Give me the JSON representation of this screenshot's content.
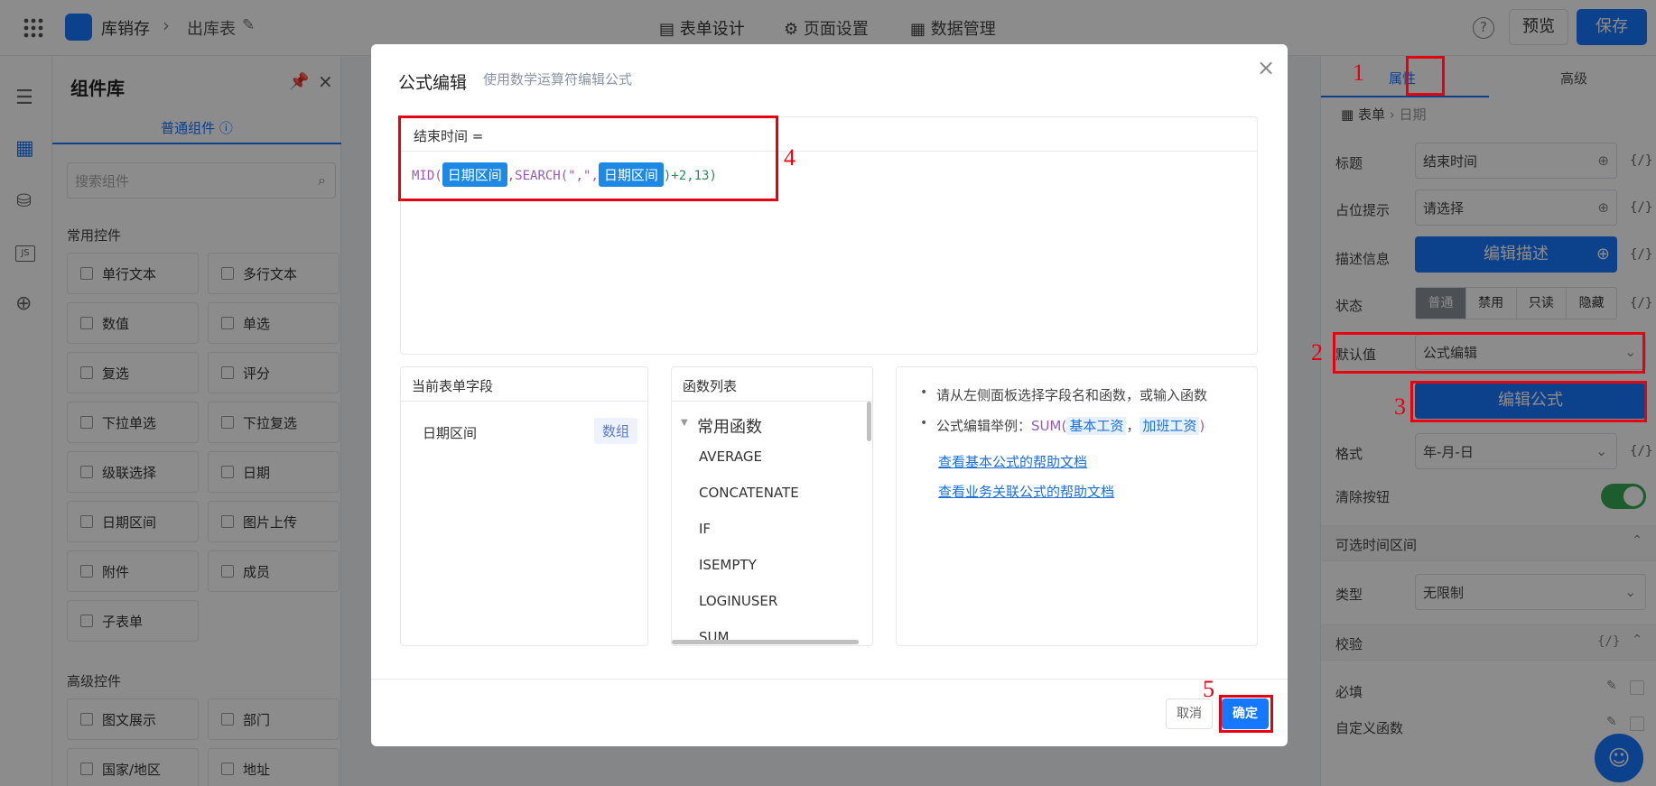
{
  "topbar": {
    "app": "库销存",
    "page": "出库表",
    "tabs": [
      "表单设计",
      "页面设置",
      "数据管理"
    ],
    "preview": "预览",
    "save": "保存"
  },
  "comp": {
    "title": "组件库",
    "tab": "普通组件",
    "search_placeholder": "搜索组件",
    "section1": "常用控件",
    "items": [
      "单行文本",
      "多行文本",
      "数值",
      "单选",
      "复选",
      "评分",
      "下拉单选",
      "下拉复选",
      "级联选择",
      "日期",
      "日期区间",
      "图片上传",
      "附件",
      "成员",
      "子表单"
    ],
    "section2": "高级控件",
    "items2": [
      "图文展示",
      "部门",
      "国家/地区",
      "地址"
    ]
  },
  "rpanel": {
    "tabs": [
      "属性",
      "高级"
    ],
    "crumb": [
      "表单",
      "日期"
    ],
    "title_label": "标题",
    "title_value": "结束时间",
    "ph_label": "占位提示",
    "ph_value": "请选择",
    "desc_label": "描述信息",
    "desc_btn": "编辑描述",
    "state_label": "状态",
    "states": [
      "普通",
      "禁用",
      "只读",
      "隐藏"
    ],
    "default_label": "默认值",
    "default_value": "公式编辑",
    "edit_formula": "编辑公式",
    "format_label": "格式",
    "format_value": "年-月-日",
    "clear_label": "清除按钮",
    "range_section": "可选时间区间",
    "type_label": "类型",
    "type_value": "无限制",
    "verify_section": "校验",
    "required": "必填",
    "custom_fn": "自定义函数",
    "fx": "{/}"
  },
  "modal": {
    "title": "公式编辑",
    "subtitle": "使用数学运算符编辑公式",
    "target": "结束时间 =",
    "f1": "MID(",
    "chip1": "日期区间",
    "f2": ",SEARCH(\",\",",
    "chip2": "日期区间",
    "f3": ")+2,13)",
    "fields_title": "当前表单字段",
    "field_name": "日期区间",
    "field_tag": "数组",
    "funcs_title": "函数列表",
    "func_group": "常用函数",
    "funcs": [
      "AVERAGE",
      "CONCATENATE",
      "IF",
      "ISEMPTY",
      "LOGINUSER",
      "SUM"
    ],
    "help1": "请从左侧面板选择字段名和函数，或输入函数",
    "help2_pre": "公式编辑举例：",
    "help2_fn": "SUM(",
    "help2_a": "基本工资",
    "help2_sep": "，",
    "help2_b": "加班工资",
    "help2_end": ")",
    "link1": "查看基本公式的帮助文档",
    "link2": "查看业务关联公式的帮助文档",
    "cancel": "取消",
    "ok": "确定",
    "close": "×"
  },
  "annotations": [
    "1",
    "2",
    "3",
    "4",
    "5"
  ],
  "colors": {
    "primary": "#1677ff",
    "annotation": "#e60012",
    "chip": "#1e88e5"
  }
}
